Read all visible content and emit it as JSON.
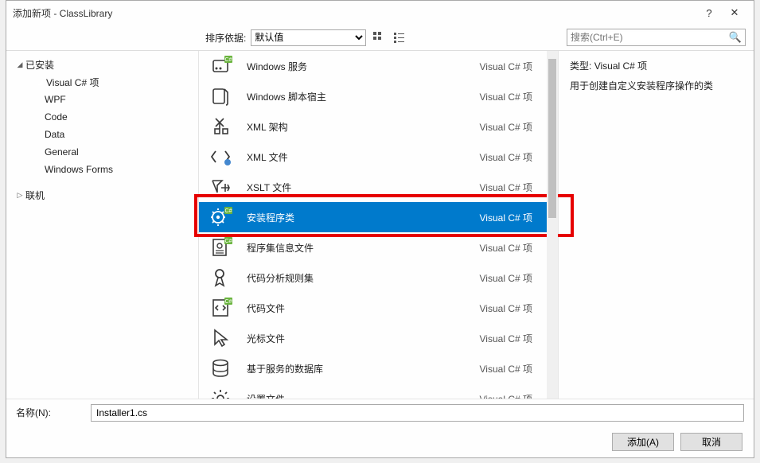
{
  "title": "添加新项 - ClassLibrary",
  "titlebar": {
    "help": "?",
    "close": "✕"
  },
  "toolbar": {
    "sort_label": "排序依据:",
    "sort_value": "默认值",
    "search_placeholder": "搜索(Ctrl+E)"
  },
  "tree": {
    "installed": "已安装",
    "csharp": "Visual C# 项",
    "wpf": "WPF",
    "code": "Code",
    "data": "Data",
    "general": "General",
    "winforms": "Windows Forms",
    "online": "联机"
  },
  "list": {
    "category": "Visual C# 项",
    "items": [
      {
        "name": "Windows 服务",
        "icon": "service"
      },
      {
        "name": "Windows 脚本宿主",
        "icon": "script"
      },
      {
        "name": "XML 架构",
        "icon": "xsd"
      },
      {
        "name": "XML 文件",
        "icon": "xml"
      },
      {
        "name": "XSLT 文件",
        "icon": "xslt"
      },
      {
        "name": "安装程序类",
        "icon": "installer",
        "selected": true
      },
      {
        "name": "程序集信息文件",
        "icon": "assembly"
      },
      {
        "name": "代码分析规则集",
        "icon": "ruleset"
      },
      {
        "name": "代码文件",
        "icon": "codefile"
      },
      {
        "name": "光标文件",
        "icon": "cursor"
      },
      {
        "name": "基于服务的数据库",
        "icon": "database"
      },
      {
        "name": "设置文件",
        "icon": "settings"
      }
    ]
  },
  "detail": {
    "type_label": "类型:",
    "type_value": "Visual C# 项",
    "description": "用于创建自定义安装程序操作的类"
  },
  "footer": {
    "name_label": "名称(N):",
    "name_value": "Installer1.cs",
    "add": "添加(A)",
    "cancel": "取消"
  }
}
